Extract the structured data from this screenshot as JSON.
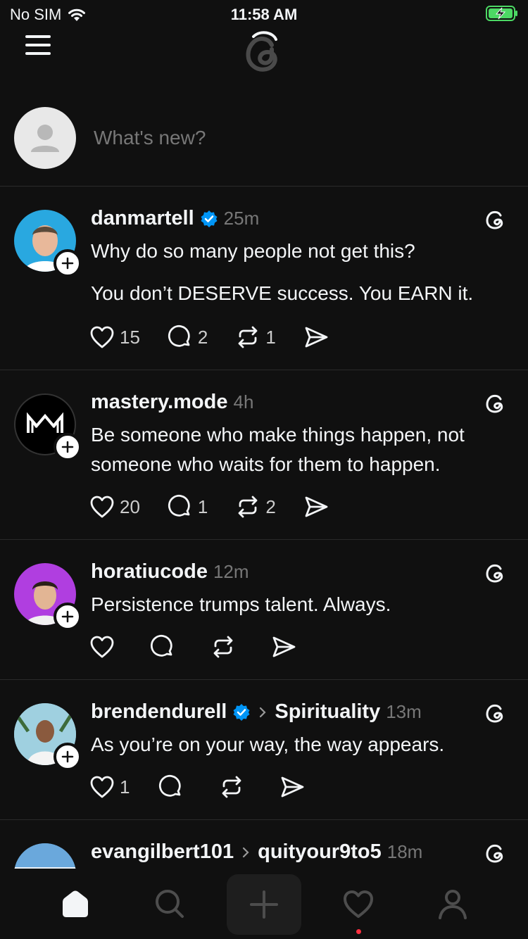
{
  "status_bar": {
    "carrier": "No SIM",
    "time": "11:58 AM"
  },
  "composer": {
    "placeholder": "What's new?"
  },
  "posts": [
    {
      "username": "danmartell",
      "verified": true,
      "time": "25m",
      "text_lines": [
        "Why do so many people not get this?",
        "You don’t DESERVE success. You EARN it."
      ],
      "likes": "15",
      "replies": "2",
      "reposts": "1"
    },
    {
      "username": "mastery.mode",
      "verified": false,
      "time": "4h",
      "text_lines": [
        "Be someone who make things happen, not",
        "someone who waits for them to happen."
      ],
      "likes": "20",
      "replies": "1",
      "reposts": "2"
    },
    {
      "username": "horatiucode",
      "verified": false,
      "time": "12m",
      "text_lines": [
        "Persistence trumps talent. Always."
      ],
      "likes": "",
      "replies": "",
      "reposts": ""
    },
    {
      "username": "brendendurell",
      "verified": true,
      "topic": "Spirituality",
      "time": "13m",
      "text_lines": [
        "As you’re on your way, the way appears."
      ],
      "likes": "1",
      "replies": "",
      "reposts": ""
    },
    {
      "username": "evangilbert101",
      "verified": false,
      "topic": "quityour9to5",
      "time": "18m"
    }
  ],
  "colors": {
    "background": "#101010",
    "text": "#f3f5f7",
    "muted": "#777777",
    "verified": "#0095f6",
    "notification": "#ff3040",
    "battery": "#4cd964"
  },
  "icons": [
    "wifi-icon",
    "battery-charging-icon",
    "menu-icon",
    "threads-logo",
    "plus-icon",
    "verified-icon",
    "heart-icon",
    "comment-icon",
    "repost-icon",
    "share-icon",
    "home-icon",
    "search-icon",
    "new-post-icon",
    "activity-icon",
    "profile-icon"
  ]
}
